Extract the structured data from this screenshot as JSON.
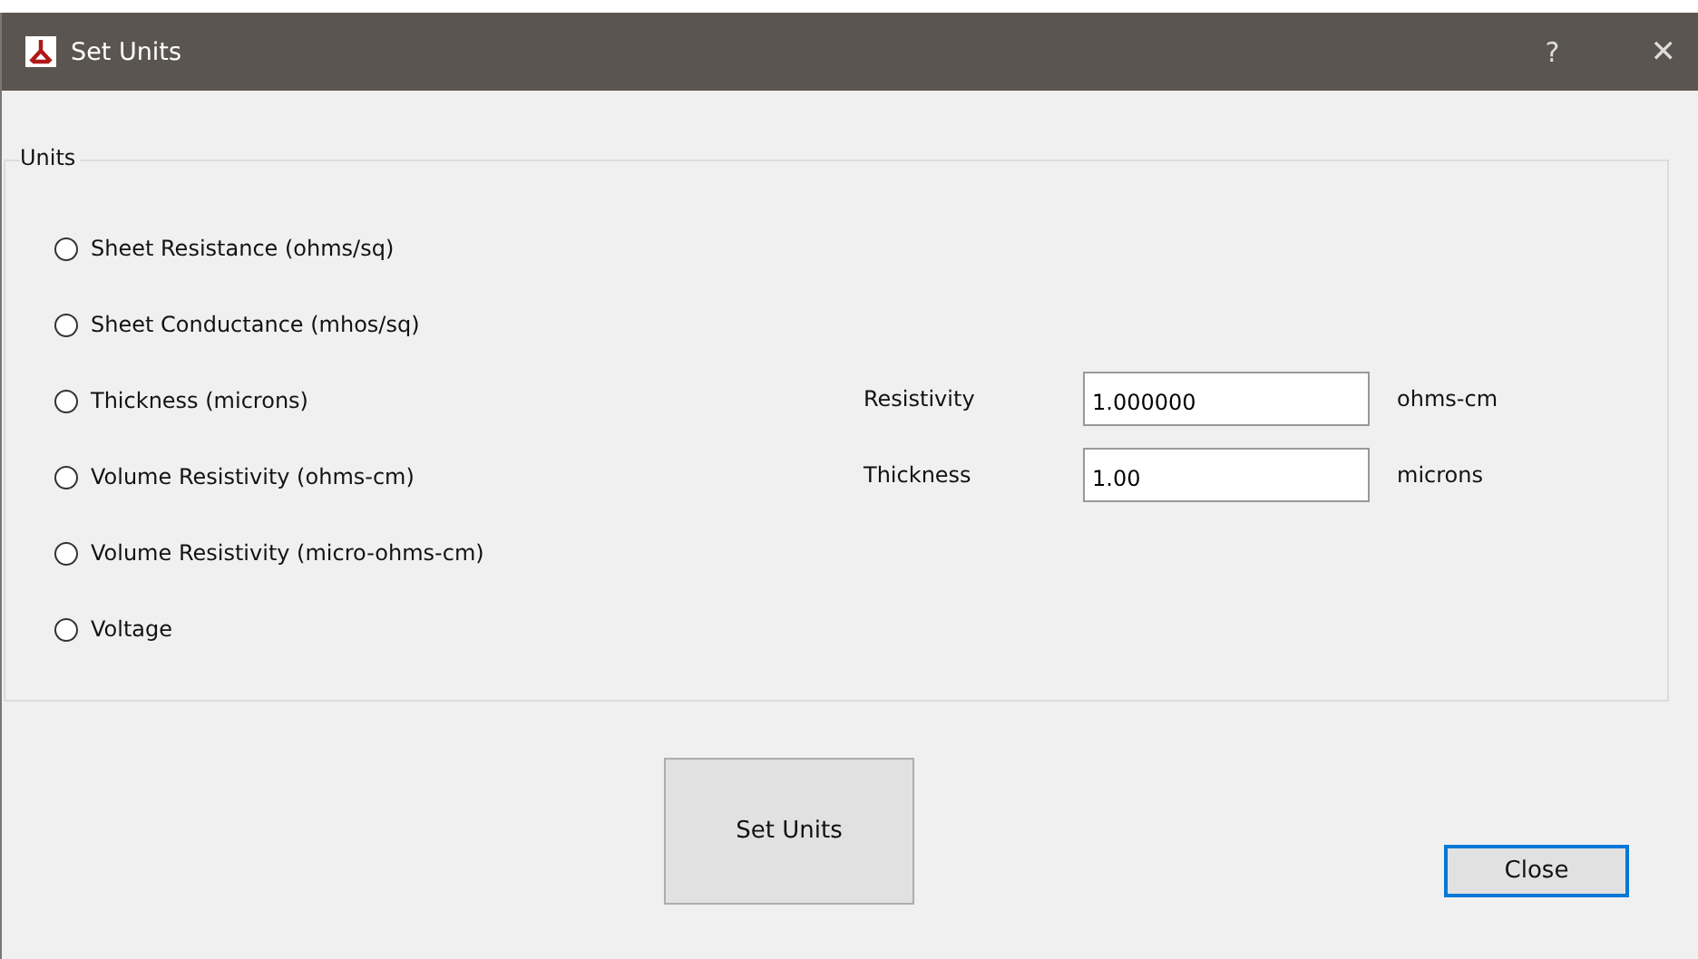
{
  "window": {
    "title": "Set Units",
    "help": "?",
    "close": "✕"
  },
  "group": {
    "title": "Units",
    "options": [
      {
        "label": "Sheet Resistance (ohms/sq)",
        "selected": false
      },
      {
        "label": "Sheet Conductance (mhos/sq)",
        "selected": false
      },
      {
        "label": "Thickness (microns)",
        "selected": false
      },
      {
        "label": "Volume Resistivity (ohms-cm)",
        "selected": false
      },
      {
        "label": "Volume Resistivity (micro-ohms-cm)",
        "selected": false
      },
      {
        "label": "Voltage",
        "selected": false
      }
    ],
    "fields": [
      {
        "label": "Resistivity",
        "value": "1.000000",
        "unit": "ohms-cm"
      },
      {
        "label": "Thickness",
        "value": "1.00",
        "unit": "microns"
      }
    ]
  },
  "buttons": [
    {
      "label": "Set Units",
      "kind": "large",
      "focused": false
    },
    {
      "label": "Close",
      "kind": "small",
      "focused": true
    }
  ]
}
